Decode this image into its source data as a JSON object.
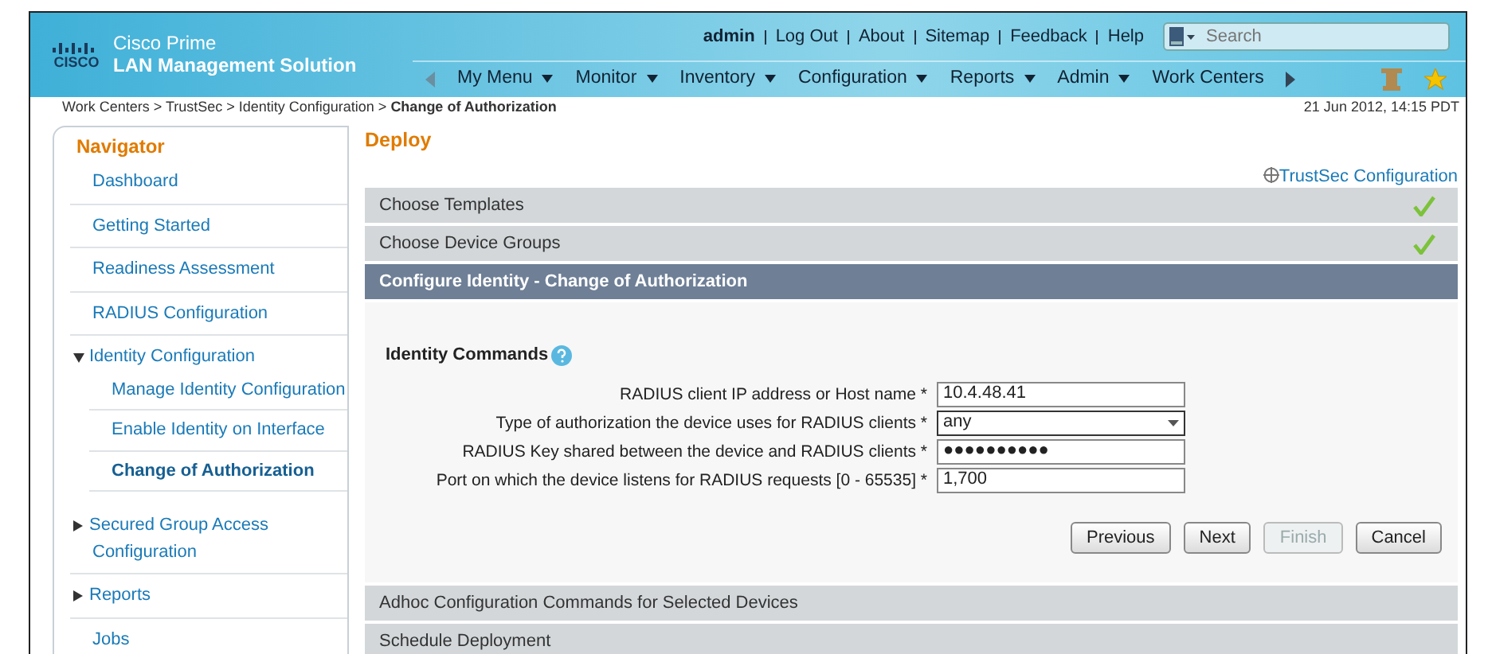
{
  "header": {
    "brand_line1": "Cisco Prime",
    "brand_line2": "LAN Management Solution",
    "logo_word": "CISCO",
    "user": "admin",
    "links": [
      "Log Out",
      "About",
      "Sitemap",
      "Feedback",
      "Help"
    ],
    "search": {
      "placeholder": "Search"
    },
    "menu": [
      "My Menu",
      "Monitor",
      "Inventory",
      "Configuration",
      "Reports",
      "Admin",
      "Work Centers"
    ]
  },
  "breadcrumb": {
    "text": "Work Centers > TrustSec > Identity Configuration > **Change of Authorization**",
    "timestamp": "21 Jun 2012, 14:15 PDT"
  },
  "navigator": {
    "title": "Navigator",
    "items": [
      {
        "label": "Dashboard",
        "selected": false
      },
      {
        "label": "Getting Started",
        "selected": false
      },
      {
        "label": "Readiness Assessment",
        "selected": false
      },
      {
        "label": "RADIUS Configuration",
        "selected": false
      },
      {
        "label": "Identity Configuration",
        "selected": false,
        "expanded": true,
        "children": [
          {
            "label": "Manage Identity Configuration",
            "selected": false
          },
          {
            "label": "Enable Identity on Interface",
            "selected": false
          },
          {
            "label": "Change of Authorization",
            "selected": true
          }
        ]
      },
      {
        "label": "Secured Group Access Configuration",
        "selected": false,
        "expanded": false
      },
      {
        "label": "Reports",
        "selected": false,
        "expanded": false
      },
      {
        "label": "Jobs",
        "selected": false
      }
    ]
  },
  "page_title": "Deploy",
  "top_link": "TrustSec Configuration",
  "steps": [
    {
      "label": "Choose Templates",
      "done": true,
      "selected": false
    },
    {
      "label": "Choose Device Groups",
      "done": true,
      "selected": false
    },
    {
      "label": "Configure Identity - Change of Authorization",
      "done": false,
      "selected": true
    },
    {
      "label": "Adhoc Configuration Commands for Selected Devices",
      "done": false,
      "selected": false
    },
    {
      "label": "Schedule Deployment",
      "done": false,
      "selected": false
    }
  ],
  "form": {
    "title": "Identity Commands",
    "fields": [
      {
        "kind": "text",
        "label": "RADIUS client IP address or Host name *",
        "value": "10.4.48.41"
      },
      {
        "kind": "select",
        "label": "Type of authorization the device uses for RADIUS clients *",
        "value": "any"
      },
      {
        "kind": "text",
        "label": "RADIUS Key shared between the device and RADIUS clients *",
        "value": "●●●●●●●●●●"
      },
      {
        "kind": "text",
        "label": "Port on which the device listens for RADIUS requests [0 - 65535] *",
        "value": "1,700"
      }
    ],
    "buttons": [
      {
        "label": "Previous",
        "disabled": false
      },
      {
        "label": "Next",
        "disabled": false
      },
      {
        "label": "Finish",
        "disabled": true
      },
      {
        "label": "Cancel",
        "disabled": false
      }
    ]
  }
}
